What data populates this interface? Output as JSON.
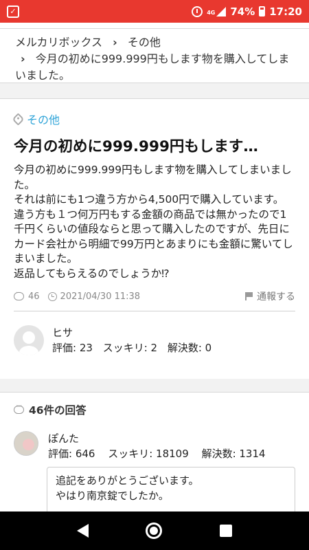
{
  "status_bar": {
    "network": "4G",
    "battery": "74%",
    "time": "17:20"
  },
  "breadcrumb": {
    "items": [
      "メルカリボックス",
      "その他",
      "今月の初めに999.999円もします物を購入してしまいました。"
    ],
    "separator": "›"
  },
  "question": {
    "category": "その他",
    "title": "今月の初めに999.999円もします…",
    "body": "今月の初めに999.999円もします物を購入してしまいました。\nそれは前にも1つ違う方から4,500円で購入しています。\n違う方も１つ何万円もする金額の商品では無かったので1千円くらいの値段ならと思って購入したのですが、先日にカード会社から明細で99万円とあまりにも金額に驚いてしまいました。\n返品してもらえるのでしょうか⁉︎",
    "answer_count": "46",
    "date": "2021/04/30 11:38",
    "report_label": "通報する"
  },
  "asker": {
    "name": "ヒサ",
    "rating": "評価: 23",
    "sukkiri": "スッキリ: 2",
    "resolved": "解決数: 0"
  },
  "answers": {
    "header": "46件の回答",
    "first": {
      "name": "ぽんた",
      "rating": "評価: 646",
      "sukkiri": "スッキリ: 18109",
      "resolved": "解決数: 1314",
      "text": "追記をありがとうございます。\nやはり南京錠でしたか。"
    }
  }
}
